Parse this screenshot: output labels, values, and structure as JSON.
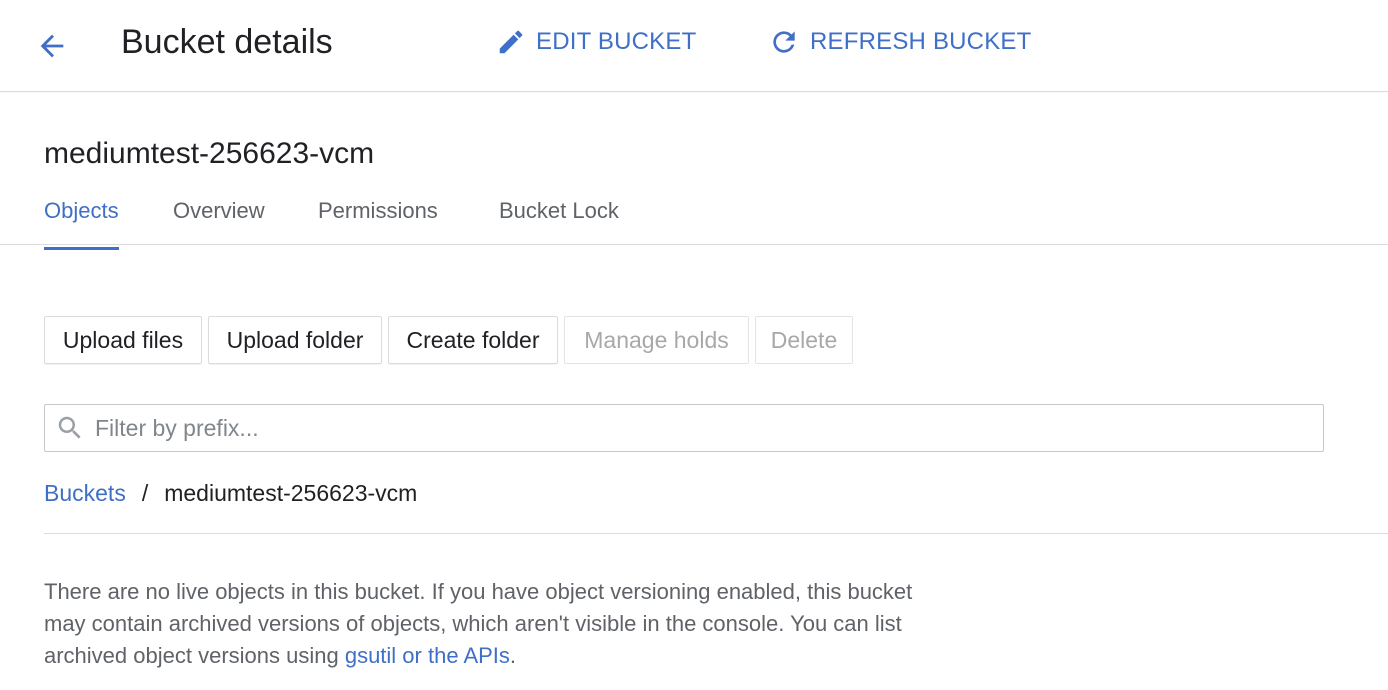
{
  "header": {
    "back_icon": "arrow-back-icon",
    "title": "Bucket details",
    "edit_label": "EDIT BUCKET",
    "edit_icon": "pencil-icon",
    "refresh_label": "REFRESH BUCKET",
    "refresh_icon": "refresh-icon"
  },
  "bucket": {
    "name": "mediumtest-256623-vcm"
  },
  "tabs": [
    {
      "label": "Objects",
      "active": true
    },
    {
      "label": "Overview",
      "active": false
    },
    {
      "label": "Permissions",
      "active": false
    },
    {
      "label": "Bucket Lock",
      "active": false
    }
  ],
  "toolbar": {
    "upload_files": "Upload files",
    "upload_folder": "Upload folder",
    "create_folder": "Create folder",
    "manage_holds": "Manage holds",
    "delete": "Delete"
  },
  "filter": {
    "icon": "search-icon",
    "placeholder": "Filter by prefix...",
    "value": ""
  },
  "breadcrumb": {
    "root": "Buckets",
    "separator": "/",
    "current": "mediumtest-256623-vcm"
  },
  "message": {
    "text": "There are no live objects in this bucket. If you have object versioning enabled, this bucket may contain archived versions of objects, which aren't visible in the console. You can list archived object versions using ",
    "link": "gsutil or the APIs",
    "end": "."
  },
  "colors": {
    "accent": "#3f6fc6",
    "text": "#202124",
    "muted": "#5f6368",
    "disabled": "#a8a8a8",
    "border": "#dadce0"
  }
}
